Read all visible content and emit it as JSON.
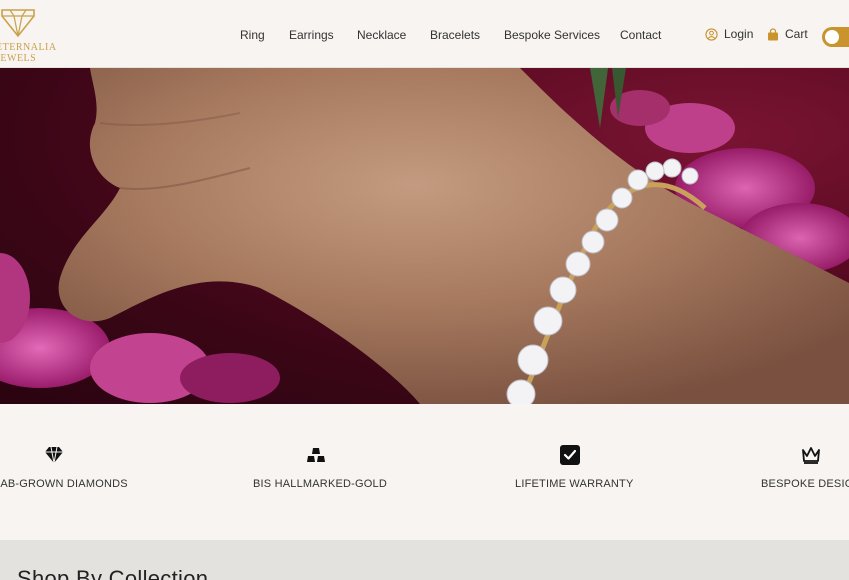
{
  "brand": {
    "line1": "ETERNALIA",
    "line2": "JEWELS",
    "color": "#c9a24a"
  },
  "nav": {
    "items": [
      {
        "label": "Ring"
      },
      {
        "label": "Earrings"
      },
      {
        "label": "Necklace"
      },
      {
        "label": "Bracelets"
      },
      {
        "label": "Bespoke Services"
      },
      {
        "label": "Contact"
      }
    ]
  },
  "header_actions": {
    "login_label": "Login",
    "login_icon": "user-circle-icon",
    "cart_label": "Cart",
    "cart_icon": "shopping-bag-icon",
    "toggle_color": "#c9932e"
  },
  "hero": {
    "image": "hand-with-diamond-tennis-bracelet"
  },
  "features": [
    {
      "label": "LAB-GROWN DIAMONDS",
      "icon": "diamond-icon"
    },
    {
      "label": "BIS HALLMARKED-GOLD",
      "icon": "gold-bars-icon"
    },
    {
      "label": "LIFETIME WARRANTY",
      "icon": "checkbox-icon"
    },
    {
      "label": "BESPOKE DESIGN",
      "icon": "crown-icon"
    }
  ],
  "collection": {
    "title": "Shop By Collection"
  }
}
